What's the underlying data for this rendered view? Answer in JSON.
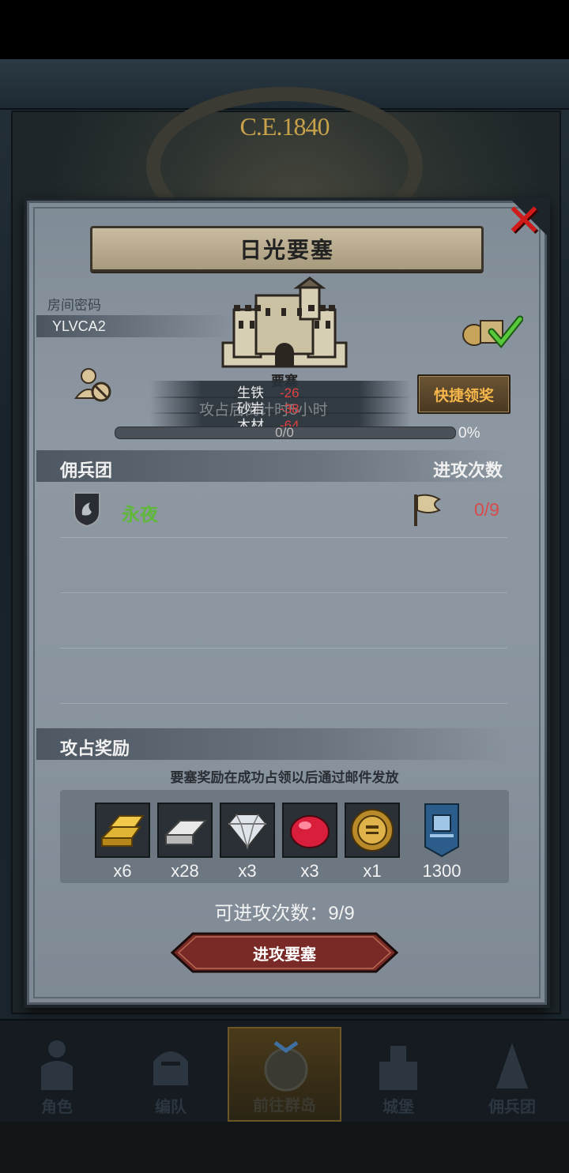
{
  "background": {
    "year_label": "C.E.1840"
  },
  "dialog": {
    "title": "日光要塞",
    "room_label": "房间密码",
    "room_code": "YLVCA2",
    "fort_label": "要塞",
    "resources": [
      {
        "name": "生铁",
        "value": "-26"
      },
      {
        "name": "砂岩",
        "value": "-38"
      },
      {
        "name": "木材",
        "value": "-64"
      }
    ],
    "overlay_text": "攻占后倒计时5小时",
    "progress": {
      "count": "0/0",
      "percent": "0%",
      "fraction": 0
    },
    "quick_claim_label": "快捷领奖",
    "close_icon": "close-x-icon"
  },
  "mercenary_section": {
    "title": "佣兵团",
    "attack_count_header": "进攻次数",
    "guilds": [
      {
        "name": "永夜",
        "attacks": "0/9"
      }
    ]
  },
  "reward_section": {
    "title": "攻占奖励",
    "note": "要塞奖励在成功占领以后通过邮件发放",
    "items": [
      {
        "icon": "gold-bar-icon",
        "count": "x6"
      },
      {
        "icon": "silver-bar-icon",
        "count": "x28"
      },
      {
        "icon": "diamond-icon",
        "count": "x3"
      },
      {
        "icon": "ruby-icon",
        "count": "x3"
      },
      {
        "icon": "golden-helmet-icon",
        "count": "x1"
      },
      {
        "icon": "fort-banner-icon",
        "count": "1300"
      }
    ]
  },
  "attack_remaining": "可进攻次数：9/9",
  "attack_button_label": "进攻要塞",
  "bottom_nav": [
    {
      "label": "角色",
      "active": false
    },
    {
      "label": "编队",
      "active": false
    },
    {
      "label": "前往群岛",
      "active": true
    },
    {
      "label": "城堡",
      "active": false
    },
    {
      "label": "佣兵团",
      "active": false
    }
  ],
  "colors": {
    "guild_name": "#5fb83a",
    "attack_ratio": "#d94a4a",
    "quick_claim": "#f4b64a",
    "close": "#d11a1a"
  }
}
